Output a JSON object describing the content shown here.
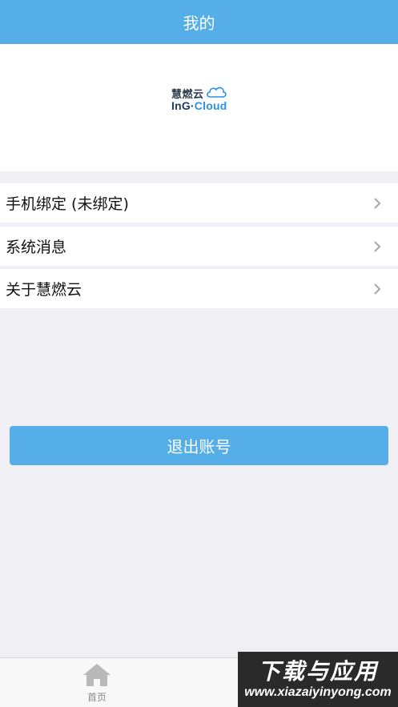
{
  "header": {
    "title": "我的"
  },
  "logo": {
    "cn": "慧燃云",
    "en_prefix": "InG·",
    "en_suffix": "Cloud"
  },
  "menu": [
    {
      "label": "手机绑定 (未绑定)"
    },
    {
      "label": "系统消息"
    },
    {
      "label": "关于慧燃云"
    }
  ],
  "logout": {
    "label": "退出账号"
  },
  "tabbar": {
    "home_label": "首页"
  },
  "watermark": {
    "cn": "下载与应用",
    "en": "www.xiazaiyinyong.com"
  },
  "colors": {
    "primary": "#56aee9",
    "background": "#efeff4"
  }
}
